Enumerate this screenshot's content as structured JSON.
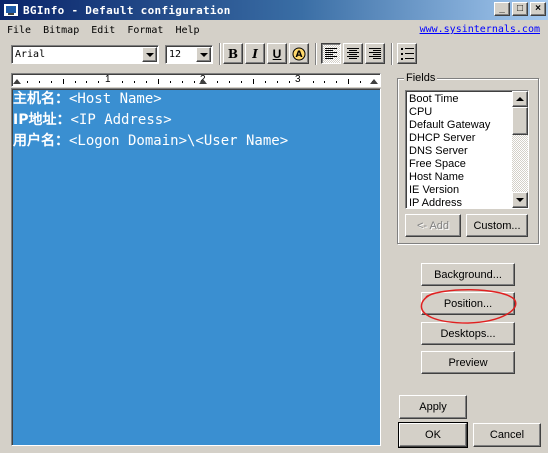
{
  "window": {
    "title": "BGInfo - Default configuration",
    "controls": {
      "minimize": "_",
      "maximize": "□",
      "close": "×"
    }
  },
  "menu": {
    "items": [
      "File",
      "Bitmap",
      "Edit",
      "Format",
      "Help"
    ],
    "link": "www.sysinternals.com"
  },
  "toolbar": {
    "font": "Arial",
    "size": "12",
    "bold": "B",
    "italic": "I",
    "underline": "U",
    "pressed_align": "left"
  },
  "ruler": {
    "numbers": [
      "1",
      "2",
      "3"
    ]
  },
  "editor": {
    "background_color": "#3a8fd1",
    "lines": [
      {
        "label": "主机名：",
        "value": "<Host Name>"
      },
      {
        "label": "IP地址：",
        "value": "<IP Address>"
      },
      {
        "label": "用户名：",
        "value": "<Logon Domain>\\<User Name>"
      }
    ]
  },
  "fields": {
    "label": "Fields",
    "items": [
      "Boot Time",
      "CPU",
      "Default Gateway",
      "DHCP Server",
      "DNS Server",
      "Free Space",
      "Host Name",
      "IE Version",
      "IP Address"
    ],
    "add_button": "<- Add",
    "custom_button": "Custom..."
  },
  "buttons": {
    "background": "Background...",
    "position": "Position...",
    "desktops": "Desktops...",
    "preview": "Preview",
    "apply": "Apply",
    "ok": "OK",
    "cancel": "Cancel"
  },
  "annotation_color": "#e02020"
}
